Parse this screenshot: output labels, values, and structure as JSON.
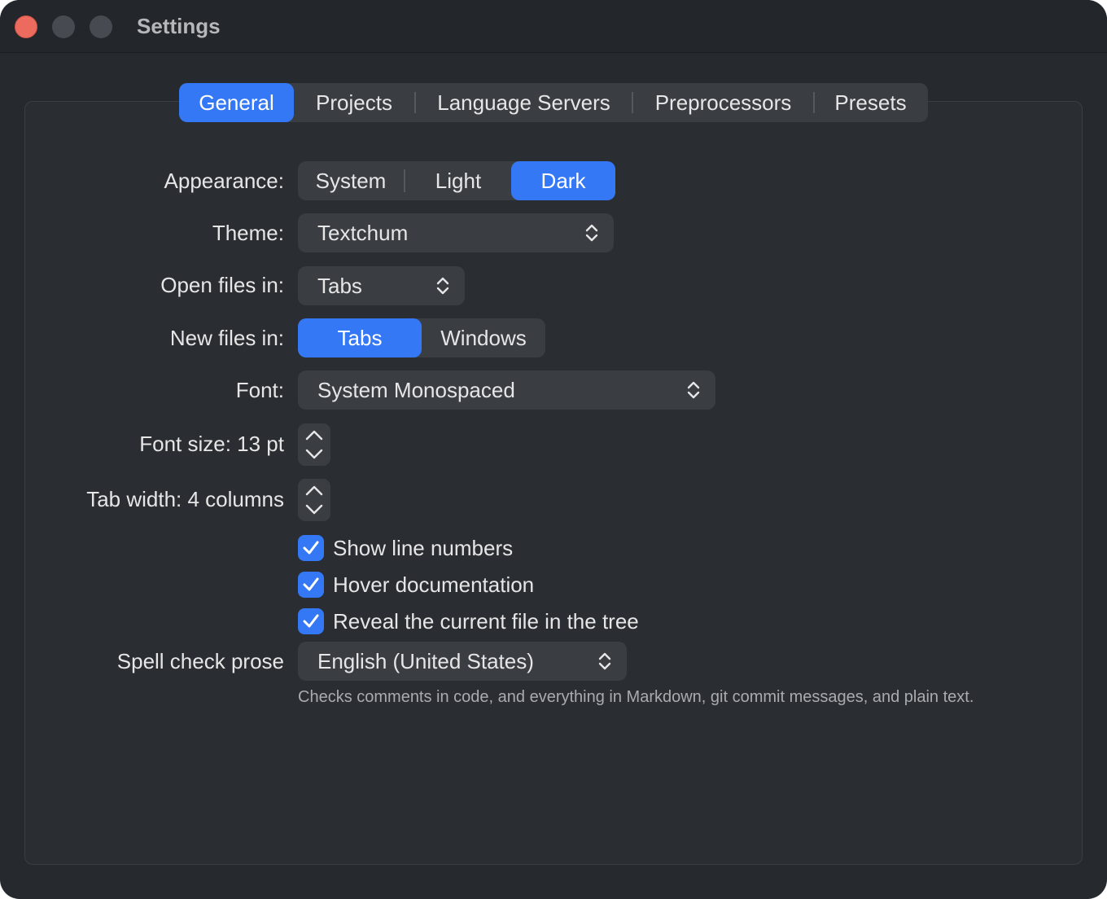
{
  "window": {
    "title": "Settings"
  },
  "tabs": [
    {
      "label": "General",
      "active": true
    },
    {
      "label": "Projects",
      "active": false
    },
    {
      "label": "Language Servers",
      "active": false
    },
    {
      "label": "Preprocessors",
      "active": false
    },
    {
      "label": "Presets",
      "active": false
    }
  ],
  "appearance": {
    "label": "Appearance:",
    "options": [
      "System",
      "Light",
      "Dark"
    ],
    "selected": "Dark"
  },
  "theme": {
    "label": "Theme:",
    "value": "Textchum"
  },
  "open_files": {
    "label": "Open files in:",
    "value": "Tabs"
  },
  "new_files": {
    "label": "New files in:",
    "options": [
      "Tabs",
      "Windows"
    ],
    "selected": "Tabs"
  },
  "font": {
    "label": "Font:",
    "value": "System Monospaced"
  },
  "font_size": {
    "label": "Font size: 13 pt"
  },
  "tab_width": {
    "label": "Tab width: 4 columns"
  },
  "checkboxes": [
    {
      "label": "Show line numbers",
      "checked": true
    },
    {
      "label": "Hover documentation",
      "checked": true
    },
    {
      "label": "Reveal the current file in the tree",
      "checked": true
    }
  ],
  "spell_check": {
    "label": "Spell check prose",
    "value": "English (United States)",
    "hint": "Checks comments in code, and everything in Markdown, git commit messages, and plain text."
  },
  "colors": {
    "accent": "#3478f6",
    "window_bg": "#26292e",
    "control_bg": "#3a3d42",
    "close_button": "#ed6a5e"
  }
}
